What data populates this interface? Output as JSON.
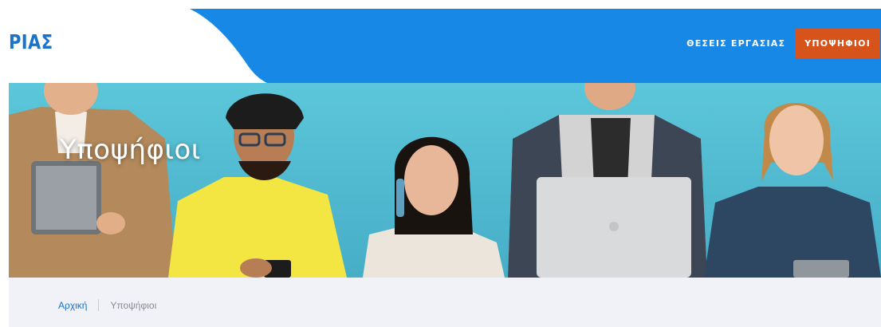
{
  "brand": {
    "logo_text": "ΡΙΑΣ"
  },
  "nav": {
    "items": [
      {
        "label": "ΘΕΣΕΙΣ ΕΡΓΑΣΙΑΣ",
        "active": false
      },
      {
        "label": "ΥΠΟΨΗΦΙΟΙ",
        "active": true
      }
    ]
  },
  "hero": {
    "title": "Υποψήφιοι"
  },
  "breadcrumb": {
    "home": "Αρχική",
    "current": "Υποψήφιοι"
  },
  "colors": {
    "header_blue": "#1788e6",
    "logo_blue": "#1a73c8",
    "active_nav": "#d6531c",
    "hero_background": "#5cc3d8",
    "breadcrumb_bar": "#f1f2f7"
  }
}
